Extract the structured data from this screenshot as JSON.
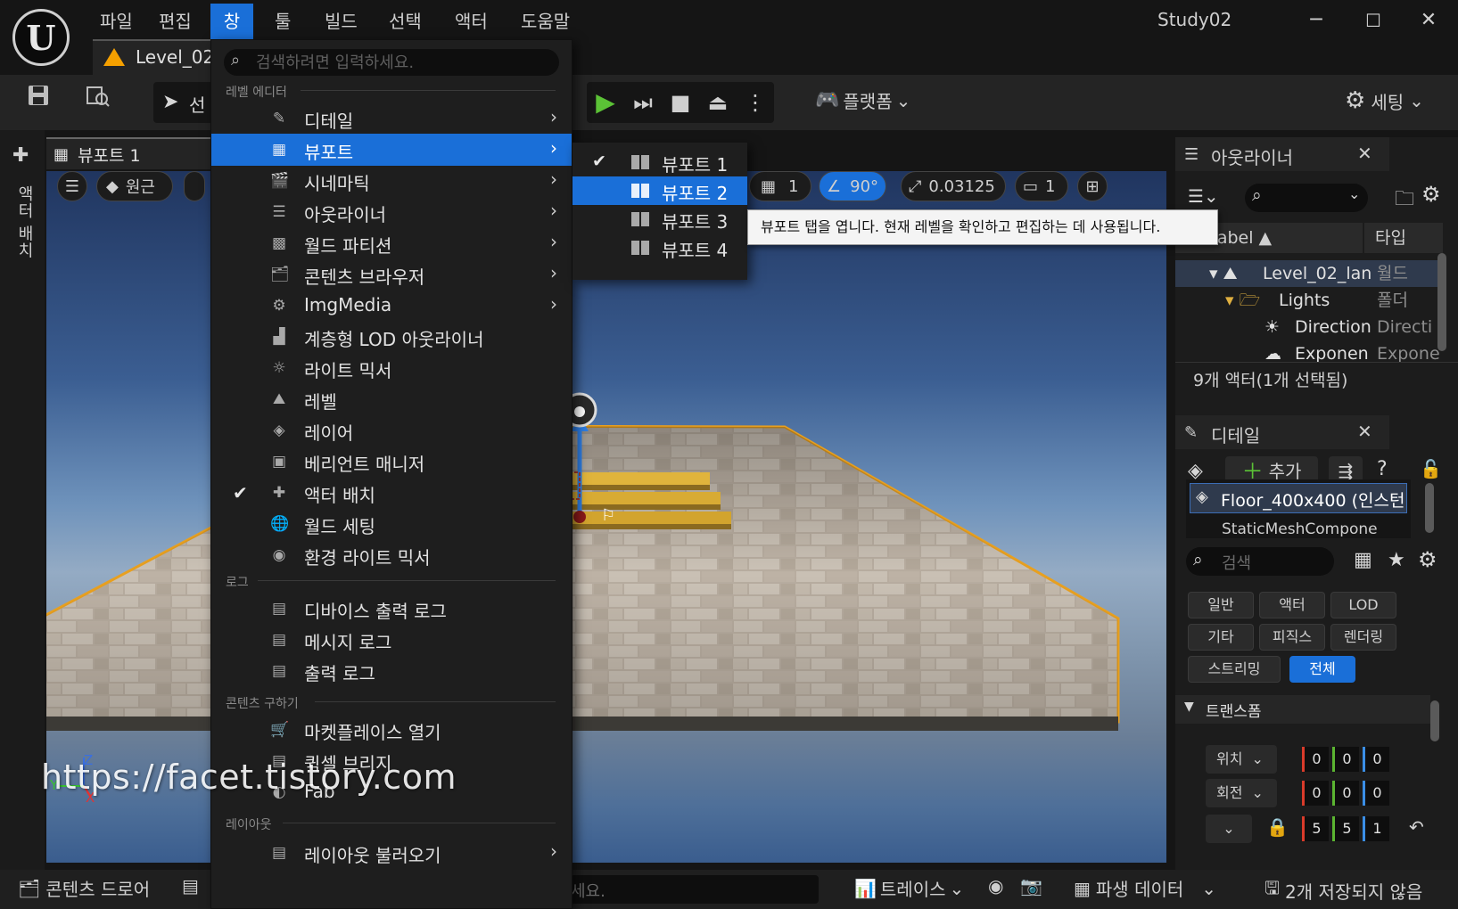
{
  "app": {
    "logo": "U",
    "title": "Study02",
    "window_buttons": {
      "minimize": "─",
      "maximize": "☐",
      "close": "✕"
    }
  },
  "menu_bar": [
    {
      "label": "파일"
    },
    {
      "label": "편집"
    },
    {
      "label": "창"
    },
    {
      "label": "툴"
    },
    {
      "label": "빌드"
    },
    {
      "label": "선택"
    },
    {
      "label": "액터"
    },
    {
      "label": "도움말"
    }
  ],
  "level_tab": {
    "label": "Level_02_"
  },
  "toolbar": {
    "mode_label": "선",
    "platform_label": "플랫폼",
    "settings_label": "세팅"
  },
  "left_strip": {
    "label": "액터 배치"
  },
  "viewport": {
    "tab_label": "뷰포트 1",
    "perspective_label": "원근",
    "grid_value": "1",
    "angle_value": "90°",
    "scale_value": "0.03125",
    "camera_value": "1",
    "watermark": "https://facet.tistory.com",
    "axes": {
      "x": "X",
      "y": "Y",
      "z": "Z"
    }
  },
  "window_menu": {
    "search_placeholder": "검색하려면 입력하세요.",
    "sections": {
      "level_editor": "레벨 에디터",
      "log": "로그",
      "get_content": "콘텐츠 구하기",
      "layout": "레이아웃"
    },
    "items": [
      {
        "label": "디테일",
        "icon": "✎",
        "arrow": "›"
      },
      {
        "label": "뷰포트",
        "icon": "▦",
        "arrow": "›"
      },
      {
        "label": "시네마틱",
        "icon": "🎬",
        "arrow": "›"
      },
      {
        "label": "아웃라이너",
        "icon": "☰",
        "arrow": "›"
      },
      {
        "label": "월드 파티션",
        "icon": "▩",
        "arrow": "›"
      },
      {
        "label": "콘텐츠 브라우저",
        "icon": "🗂",
        "arrow": "›"
      },
      {
        "label": "ImgMedia",
        "icon": "⚙",
        "arrow": "›"
      },
      {
        "label": "계층형 LOD 아웃라이너",
        "icon": "▟"
      },
      {
        "label": "라이트 믹서",
        "icon": "☼"
      },
      {
        "label": "레벨",
        "icon": "⛰"
      },
      {
        "label": "레이어",
        "icon": "◈"
      },
      {
        "label": "베리언트 매니저",
        "icon": "▣"
      },
      {
        "label": "액터 배치",
        "icon": "✚",
        "check": "✔"
      },
      {
        "label": "월드 세팅",
        "icon": "🌐"
      },
      {
        "label": "환경 라이트 믹서",
        "icon": "◉"
      }
    ],
    "log_items": [
      {
        "label": "디바이스 출력 로그",
        "icon": "▤"
      },
      {
        "label": "메시지 로그",
        "icon": "▤"
      },
      {
        "label": "출력 로그",
        "icon": "▤"
      }
    ],
    "content_items": [
      {
        "label": "마켓플레이스 열기",
        "icon": "🛒"
      },
      {
        "label": "퀵셀 브리지",
        "icon": "▤"
      },
      {
        "label": "Fab",
        "icon": "◐"
      }
    ],
    "layout_items": [
      {
        "label": "레이아웃 불러오기",
        "icon": "▤",
        "arrow": "›"
      }
    ]
  },
  "viewport_submenu": {
    "items": [
      {
        "label": "뷰포트 1",
        "check": "✔"
      },
      {
        "label": "뷰포트 2"
      },
      {
        "label": "뷰포트 3"
      },
      {
        "label": "뷰포트 4"
      }
    ],
    "tooltip": "뷰포트 탭을 엽니다. 현재 레벨을 확인하고 편집하는 데 사용됩니다."
  },
  "outliner": {
    "title": "아웃라이너",
    "close": "✕",
    "col_label": "em Label ▲",
    "col_type": "타입",
    "rows": [
      {
        "name": "Level_02_lan",
        "type": "월드"
      },
      {
        "name": "Lights",
        "type": "폴더"
      },
      {
        "name": "Direction",
        "type": "Directi"
      },
      {
        "name": "Exponen",
        "type": "Expone"
      }
    ],
    "status": "9개 액터(1개 선택됨)"
  },
  "details": {
    "title": "디테일",
    "close": "✕",
    "add_label": "추가",
    "component_name": "Floor_400x400 (인스턴스",
    "component_sub": "StaticMeshCompone",
    "search_placeholder": "검색",
    "categories": [
      "일반",
      "액터",
      "LOD",
      "기타",
      "피직스",
      "렌더링",
      "스트리밍",
      "전체"
    ],
    "transform_header": "트랜스폼",
    "location_label": "위치",
    "rotation_label": "회전",
    "location": [
      "0",
      "0",
      "0"
    ],
    "rotation": [
      "0",
      "0",
      "0"
    ],
    "scale": [
      "5",
      "5",
      "1"
    ]
  },
  "bottom_bar": {
    "content_drawer": "콘텐츠 드로어",
    "cmd_placeholder": "세요.",
    "trace": "트레이스",
    "derived_data": "파생 데이터",
    "unsaved": "2개 저장되지 않음"
  }
}
